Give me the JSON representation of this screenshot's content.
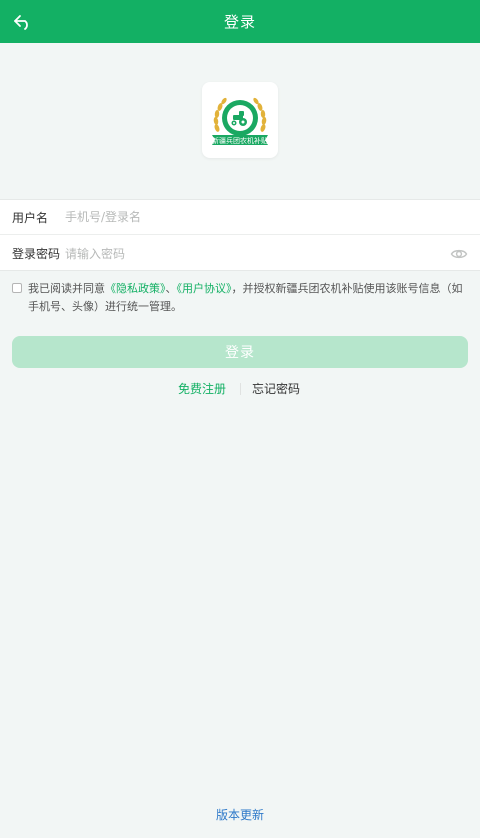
{
  "header": {
    "title": "登录",
    "accent_color": "#13b064"
  },
  "logo": {
    "text": "新疆兵团农机补贴",
    "icon": "tractor-wheat-logo"
  },
  "form": {
    "username_label": "用户名",
    "username_placeholder": "手机号/登录名",
    "password_label": "登录密码",
    "password_placeholder": "请输入密码",
    "password_toggle_icon": "eye-icon"
  },
  "agreement": {
    "prefix": "我已阅读并同意",
    "privacy_link": "《隐私政策》",
    "separator": "、",
    "user_link": "《用户协议》",
    "suffix": "，并授权新疆兵团农机补贴使用该账号信息（如手机号、头像）进行统一管理。"
  },
  "login_button": "登录",
  "links": {
    "register": "免费注册",
    "forgot": "忘记密码"
  },
  "footer": {
    "version_update": "版本更新"
  }
}
